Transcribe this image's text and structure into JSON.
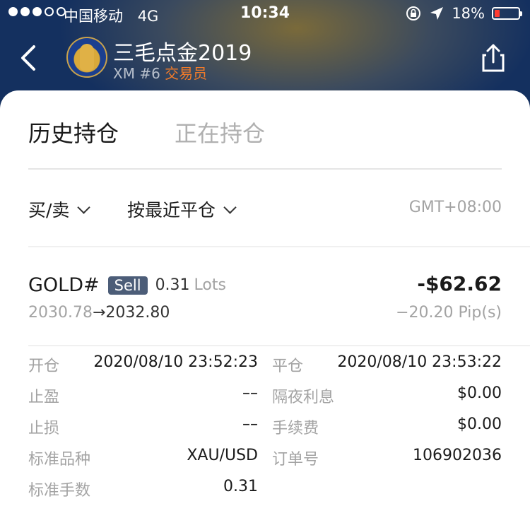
{
  "status_bar": {
    "carrier": "中国移动",
    "network": "4G",
    "time": "10:34",
    "battery_percent": "18%",
    "battery_level": 0.18
  },
  "header": {
    "name": "三毛点金2019",
    "account": "XM #6",
    "role": "交易员"
  },
  "tabs": {
    "history": "历史持仓",
    "open": "正在持仓"
  },
  "filters": {
    "type": "买/卖",
    "sort": "按最近平仓",
    "timezone": "GMT+08:00"
  },
  "position": {
    "symbol": "GOLD#",
    "side": "Sell",
    "lots_value": "0.31",
    "lots_unit": "Lots",
    "open_price": "2030.78",
    "arrow": "→",
    "close_price": "2032.80",
    "pnl": "-$62.62",
    "pips": "−20.20 Pip(s)"
  },
  "details": {
    "open_time_label": "开仓",
    "open_time": "2020/08/10 23:52:23",
    "close_time_label": "平仓",
    "close_time": "2020/08/10 23:53:22",
    "take_profit_label": "止盈",
    "take_profit": "––",
    "swap_label": "隔夜利息",
    "swap": "$0.00",
    "stop_loss_label": "止损",
    "stop_loss": "––",
    "commission_label": "手续费",
    "commission": "$0.00",
    "instrument_label": "标准品种",
    "instrument": "XAU/USD",
    "order_label": "订单号",
    "order": "106902036",
    "std_lots_label": "标准手数",
    "std_lots": "0.31"
  }
}
